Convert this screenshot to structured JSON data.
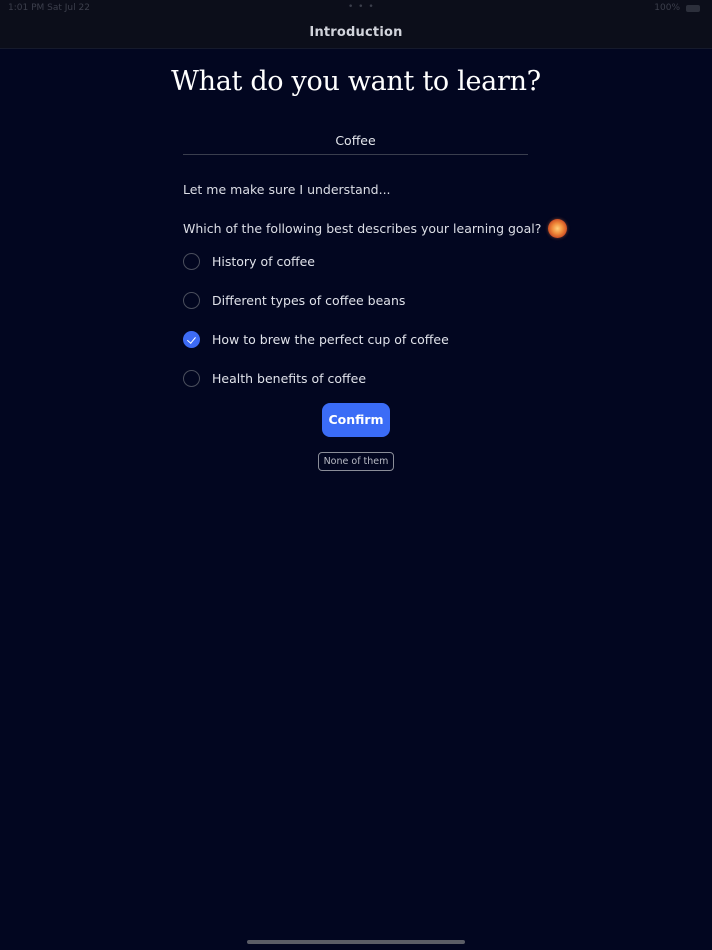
{
  "status_bar": {
    "time": "1:01 PM   Sat Jul 22",
    "dots": "• • •",
    "right": "100%"
  },
  "nav": {
    "title": "Introduction"
  },
  "main": {
    "heading": "What do you want to learn?",
    "topic": "Coffee",
    "prompt": "Let me make sure I understand...",
    "question": "Which of the following best describes your learning goal?",
    "options": [
      {
        "label": "History of coffee",
        "selected": false
      },
      {
        "label": "Different types of coffee beans",
        "selected": false
      },
      {
        "label": "How to brew the perfect cup of coffee",
        "selected": true
      },
      {
        "label": "Health benefits of coffee",
        "selected": false
      }
    ],
    "confirm_label": "Confirm",
    "none_label": "None of them"
  },
  "colors": {
    "background": "#020620",
    "accent": "#3b6cf6"
  }
}
